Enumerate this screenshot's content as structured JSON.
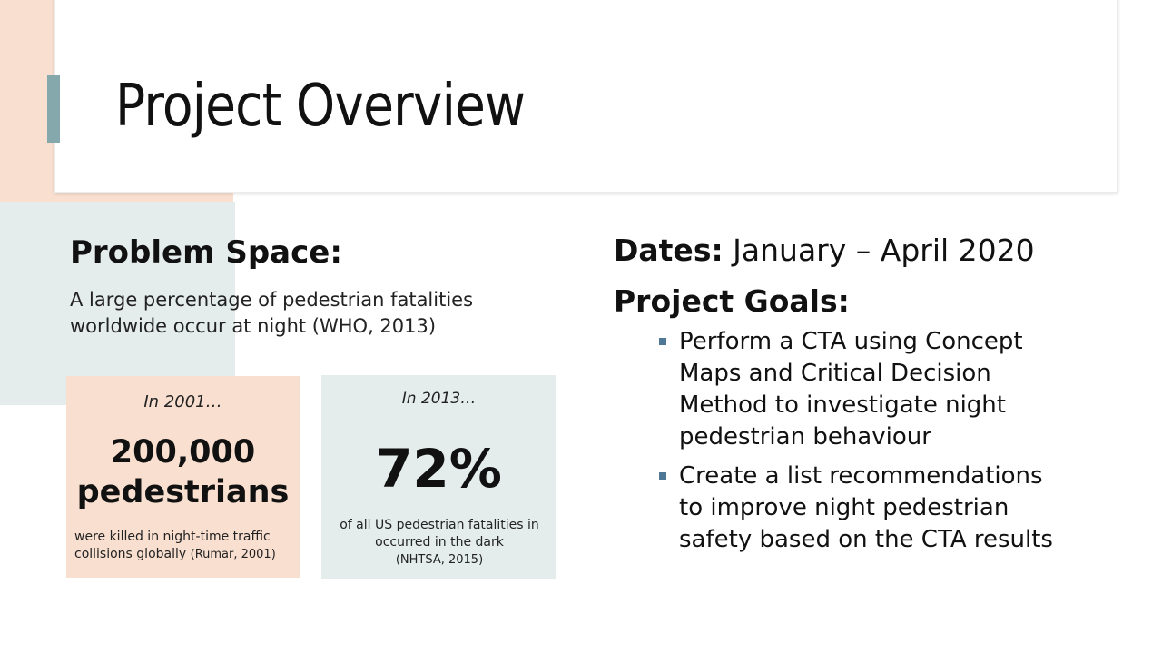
{
  "slide": {
    "title": "Project Overview",
    "accent_color": "#84a8ac"
  },
  "problem": {
    "heading": "Problem Space:",
    "body": "A large percentage of pedestrian fatalities worldwide occur at night (WHO, 2013)"
  },
  "stats": [
    {
      "caption": "In 2001…",
      "number": "200,000",
      "unit": "pedestrians",
      "note": "were killed in night-time traffic collisions globally",
      "source": "(Rumar, 2001)",
      "bg_color": "#f9dfcf"
    },
    {
      "caption": "In 2013…",
      "number": "72%",
      "note": "of all US pedestrian fatalities in occurred in the dark",
      "source": "(NHTSA, 2015)",
      "bg_color": "#e4edec"
    }
  ],
  "dates": {
    "label": "Dates:",
    "value": "January – April 2020"
  },
  "goals": {
    "heading": "Project Goals:",
    "items": [
      "Perform a CTA using Concept Maps and Critical Decision Method to investigate night pedestrian behaviour",
      "Create a list recommendations to improve night pedestrian safety based on the CTA results"
    ],
    "bullet_color": "#4f7896"
  }
}
